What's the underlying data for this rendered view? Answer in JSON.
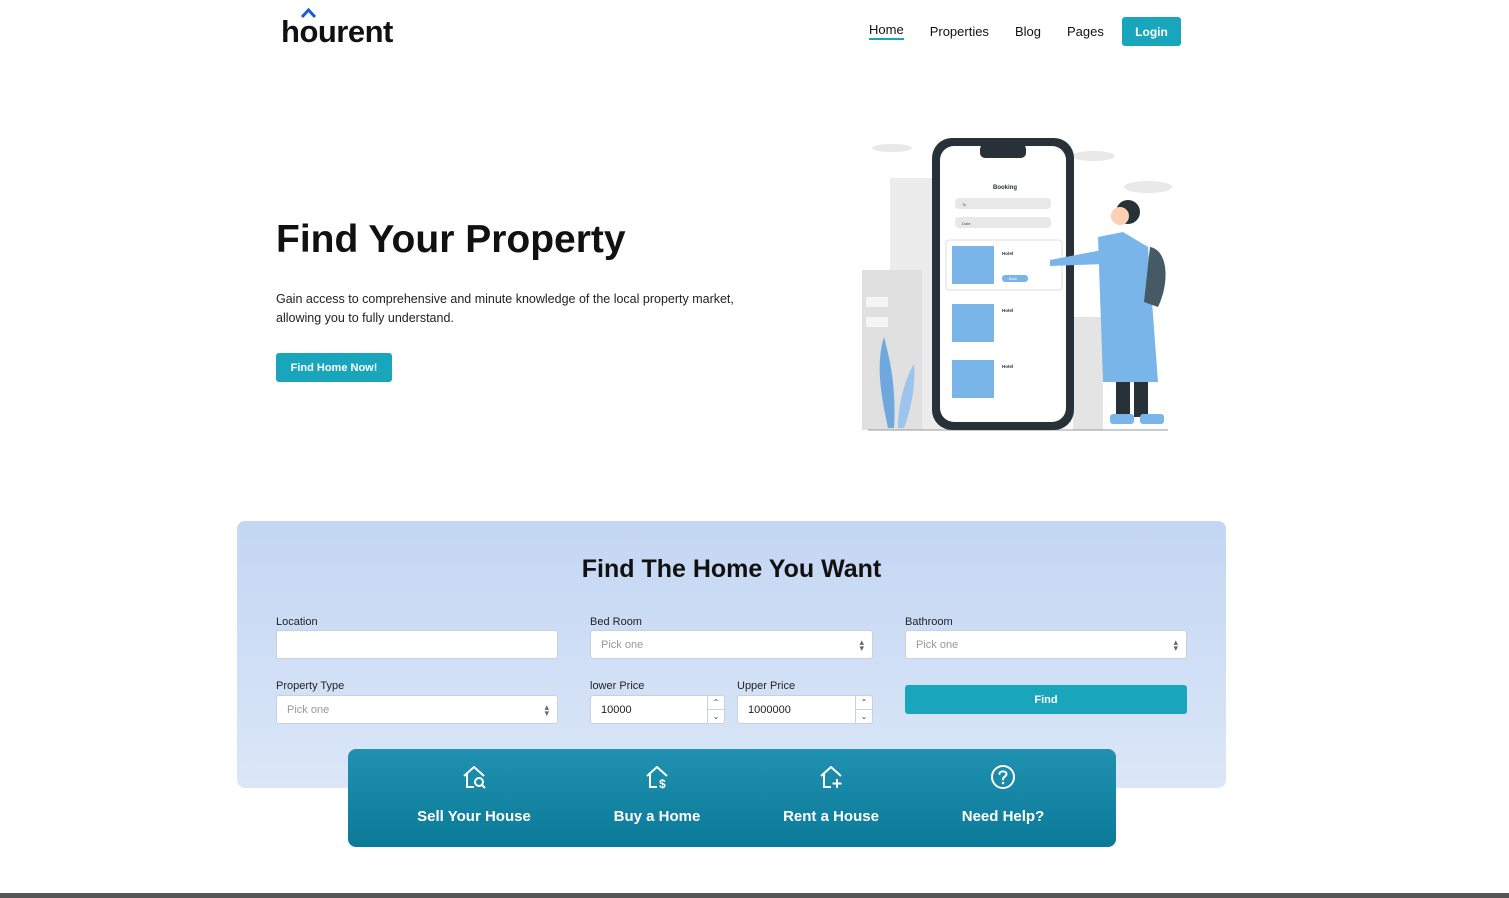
{
  "brand": {
    "logo_text_before": "h",
    "logo_text_o": "o",
    "logo_text_after": "urent",
    "accent": "#1a5bd6"
  },
  "nav": {
    "items": [
      {
        "label": "Home",
        "active": true
      },
      {
        "label": "Properties"
      },
      {
        "label": "Blog"
      },
      {
        "label": "Pages"
      }
    ],
    "login_label": "Login"
  },
  "hero": {
    "title": "Find Your Property",
    "description": "Gain access to comprehensive and minute knowledge of the local property market, allowing you to fully understand.",
    "cta_label": "Find Home Now!",
    "illustration": {
      "screen_title": "Booking",
      "field1": "To",
      "field2": "Date",
      "card_label": "Hotel",
      "button_label": "Book"
    }
  },
  "search": {
    "title": "Find The Home You Want",
    "location_label": "Location",
    "location_value": "",
    "bedroom_label": "Bed Room",
    "bedroom_value": "Pick one",
    "bathroom_label": "Bathroom",
    "bathroom_value": "Pick one",
    "property_type_label": "Property Type",
    "property_type_value": "Pick one",
    "lower_price_label": "lower Price",
    "lower_price_value": "10000",
    "upper_price_label": "Upper Price",
    "upper_price_value": "1000000",
    "find_label": "Find"
  },
  "services": [
    {
      "label": "Sell Your House",
      "icon": "house-search-icon"
    },
    {
      "label": "Buy a Home",
      "icon": "house-dollar-icon"
    },
    {
      "label": "Rent a House",
      "icon": "house-plus-icon"
    },
    {
      "label": "Need Help?",
      "icon": "question-circle-icon"
    }
  ],
  "colors": {
    "primary": "#19a6bd",
    "panel": "#c3d6f3",
    "services_bar": "#0b7a99"
  }
}
